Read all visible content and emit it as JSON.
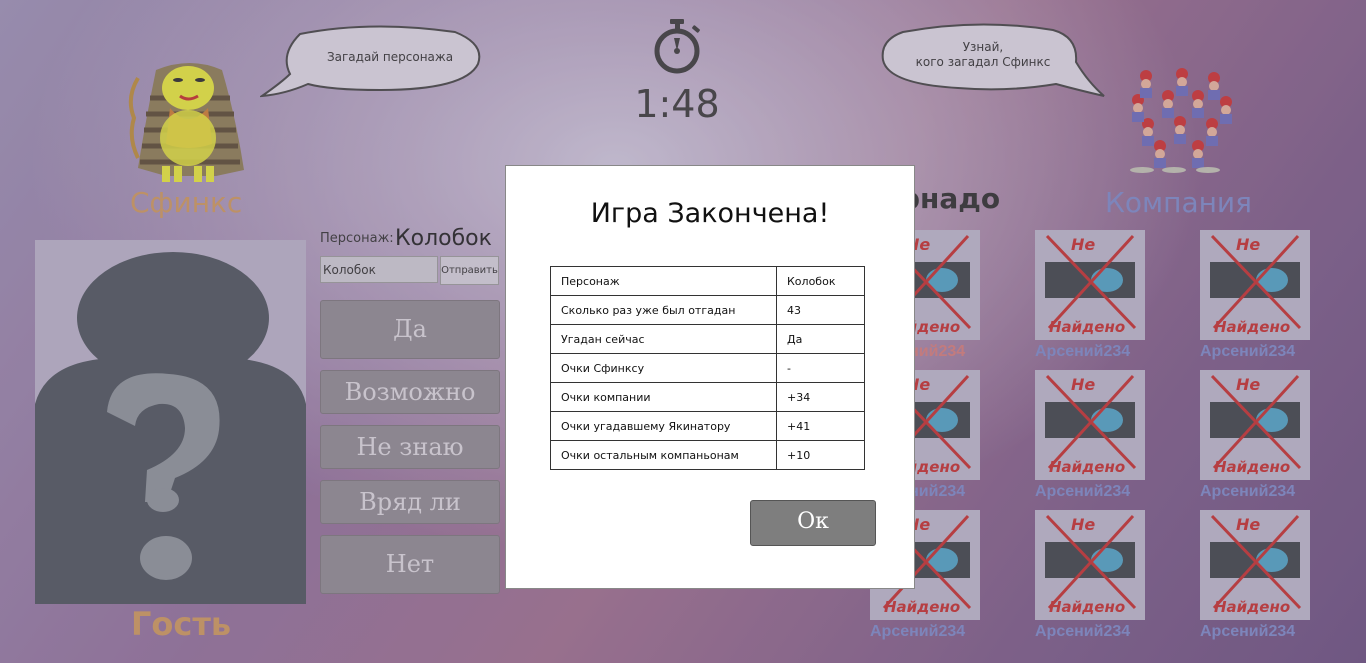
{
  "bubbles": {
    "left_text": "Загадай персонажа",
    "right_line1": "Узнай,",
    "right_line2": "кого загадал Сфинкс"
  },
  "timer": {
    "value": "1:48",
    "icon": "stopwatch-icon"
  },
  "roles": {
    "sphinx_label": "Сфинкс",
    "company_label": "Компания",
    "partial_player_label": "рнадо",
    "sphinx_color": "#c8955c",
    "company_color": "#7a87c4"
  },
  "guest": {
    "name": "Гость"
  },
  "character": {
    "label": "Персонаж:",
    "value": "Колобок",
    "input_value": "Колобок",
    "send_label": "Отправить"
  },
  "answers": [
    "Да",
    "Возможно",
    "Не знаю",
    "Вряд ли",
    "Нет"
  ],
  "tiles": {
    "image_text_top": "Не",
    "image_text_bottom": "Найдено",
    "names": [
      "Арсений234",
      "Арсений234",
      "Арсений234",
      "Арсений234",
      "Арсений234",
      "Арсений234",
      "Арсений234",
      "Арсений234",
      "Арсений234"
    ],
    "first_name_color": "#d07a78"
  },
  "modal": {
    "title": "Игра Закончена!",
    "rows": [
      {
        "label": "Персонаж",
        "value": "Колобок"
      },
      {
        "label": "Сколько раз уже был отгадан",
        "value": "43"
      },
      {
        "label": "Угадан сейчас",
        "value": "Да"
      },
      {
        "label": "Очки Сфинксу",
        "value": "-"
      },
      {
        "label": "Очки компании",
        "value": "+34"
      },
      {
        "label": "Очки угадавшему Якинатору",
        "value": "+41"
      },
      {
        "label": "Очки остальным компаньонам",
        "value": "+10"
      }
    ],
    "ok_label": "Ок"
  }
}
